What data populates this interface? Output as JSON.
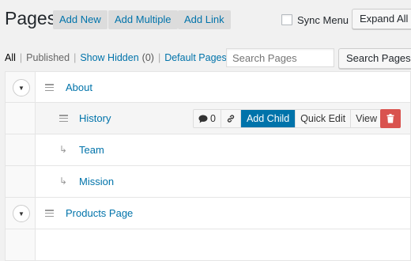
{
  "header": {
    "title": "Pages",
    "add_new": "Add New",
    "add_multiple": "Add Multiple",
    "add_link": "Add Link",
    "sync_menu": "Sync Menu",
    "expand_all": "Expand All"
  },
  "filters": {
    "all": "All",
    "published": "Published",
    "show_hidden": "Show Hidden",
    "hidden_count": "(0)",
    "default_pages": "Default Pages",
    "separator": "|"
  },
  "search": {
    "placeholder": "Search Pages",
    "button": "Search Pages"
  },
  "rows": [
    {
      "title": "About",
      "toggle": "▼"
    },
    {
      "title": "History",
      "comment_count": "0",
      "add_child": "Add Child",
      "quick_edit": "Quick Edit",
      "view": "View"
    },
    {
      "title": "Team",
      "arrow": "↳"
    },
    {
      "title": "Mission",
      "arrow": "↳"
    },
    {
      "title": "Products Page",
      "toggle": "▼"
    }
  ],
  "colors": {
    "link": "#0073aa",
    "primary": "#0073aa",
    "danger": "#d9534f"
  }
}
